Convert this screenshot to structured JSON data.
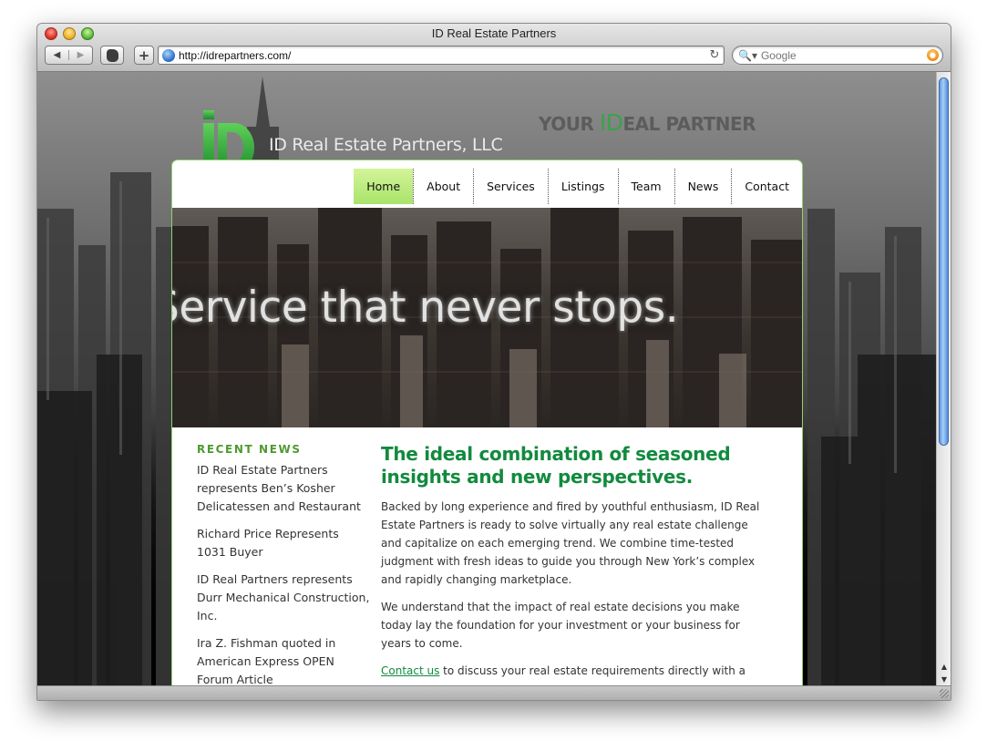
{
  "browser": {
    "window_title": "ID Real Estate Partners",
    "url": "http://idrepartners.com/",
    "search_placeholder": "Google",
    "add_label": "+",
    "back_label": "◀",
    "forward_label": "▶",
    "reload_label": "↻",
    "search_icon": "🔍▾",
    "scroll_up_label": "▲",
    "scroll_down_label": "▼"
  },
  "header": {
    "site_name": "ID Real Estate Partners, LLC",
    "tagline_prefix": "YOUR ",
    "tagline_id": "ID",
    "tagline_suffix": "EAL PARTNER"
  },
  "nav": {
    "items": [
      "Home",
      "About",
      "Services",
      "Listings",
      "Team",
      "News",
      "Contact"
    ],
    "active": "Home"
  },
  "hero": {
    "text": "Service that never stops."
  },
  "sidebar": {
    "heading": "RECENT NEWS",
    "news": [
      "ID Real Estate Partners represents Ben’s Kosher Delicatessen and Restaurant",
      "Richard Price Represents 1031 Buyer",
      "ID Real Partners represents Durr Mechanical Construction, Inc.",
      "Ira Z. Fishman quoted in American Express OPEN Forum Article"
    ]
  },
  "main": {
    "heading": "The ideal combination of seasoned insights and new perspectives.",
    "paragraph1": "Backed by long experience and fired by youthful enthusiasm, ID Real Estate Partners is ready to solve virtually any real estate challenge and capitalize on each emerging trend. We combine time-tested judgment with fresh ideas to guide you through New York’s complex and rapidly changing marketplace.",
    "paragraph2": "We understand that the impact of real estate decisions you make today lay the foundation for your investment or your business for years to come.",
    "contact_link": "Contact us",
    "paragraph3_rest": " to discuss your real estate requirements directly with a"
  },
  "colors": {
    "brand_green": "#128a3e",
    "nav_active": "#a9e36a",
    "news_heading": "#4e9a2f"
  }
}
